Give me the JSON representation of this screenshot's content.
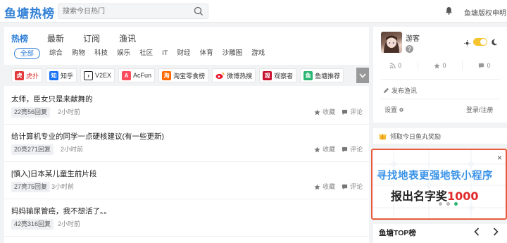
{
  "header": {
    "logo": "鱼塘热榜",
    "search_placeholder": "搜索今日热门",
    "copyright": "鱼塘版权申明"
  },
  "main": {
    "tabs": [
      {
        "label": "热榜",
        "active": true
      },
      {
        "label": "最新",
        "active": false
      },
      {
        "label": "订阅",
        "active": false
      },
      {
        "label": "渔讯",
        "active": false
      }
    ],
    "categories": [
      {
        "label": "全部",
        "active": true
      },
      {
        "label": "综合"
      },
      {
        "label": "购物"
      },
      {
        "label": "科技"
      },
      {
        "label": "娱乐"
      },
      {
        "label": "社区"
      },
      {
        "label": "IT"
      },
      {
        "label": "财经"
      },
      {
        "label": "体育"
      },
      {
        "label": "沙雕图"
      },
      {
        "label": "游戏"
      }
    ],
    "sources": [
      {
        "label": "虎扑",
        "icon": "hupu-icon",
        "color": "#e23b3b",
        "active": true
      },
      {
        "label": "知乎",
        "icon": "zhihu-icon",
        "color": "#1772f6"
      },
      {
        "label": "V2EX",
        "icon": "v2ex-icon",
        "color": "#222222"
      },
      {
        "label": "AcFun",
        "icon": "acfun-icon",
        "color": "#fd4c5c"
      },
      {
        "label": "淘宝零食榜",
        "icon": "taobao-icon",
        "color": "#ff6a00"
      },
      {
        "label": "微博热搜",
        "icon": "weibo-icon",
        "color": "#e6162d"
      },
      {
        "label": "观察者",
        "icon": "guancha-icon",
        "color": "#c8102e"
      },
      {
        "label": "鱼塘推荐",
        "icon": "yutang-icon",
        "color": "#2bb673"
      }
    ],
    "items": [
      {
        "title": "太师，臣女只是来献舞的",
        "replies": "22亮56回复",
        "time": "2小时前"
      },
      {
        "title": "给计算机专业的同学一点硬核建议(有一些更新)",
        "replies": "20亮271回复",
        "time": "2小时前"
      },
      {
        "title": "[慎入]日本某儿童生前片段",
        "replies": "27亮75回复",
        "time": "3小时前"
      },
      {
        "title": "妈妈输尿管癌，我不想活了。。",
        "replies": "42亮316回复",
        "time": "2小时前"
      }
    ],
    "fav_label": "收藏",
    "comment_label": "评论"
  },
  "profile": {
    "username": "游客",
    "badge": "?",
    "stats": [
      "0",
      "0",
      "0"
    ],
    "post_label": "发布渔讯",
    "settings_label": "设置",
    "login_label": "登录/注册"
  },
  "reward": {
    "label": "领取今日鱼丸奖励"
  },
  "ad": {
    "line1": "寻找地表更强地铁小程序",
    "line2_prefix": "报出名字奖",
    "line2_number": "1000",
    "close": "×"
  },
  "top": {
    "title": "鱼塘TOP榜"
  },
  "colors": {
    "accent": "#2f7fd6",
    "ad_border": "#e65b3d",
    "toggle": "#f5c430"
  }
}
